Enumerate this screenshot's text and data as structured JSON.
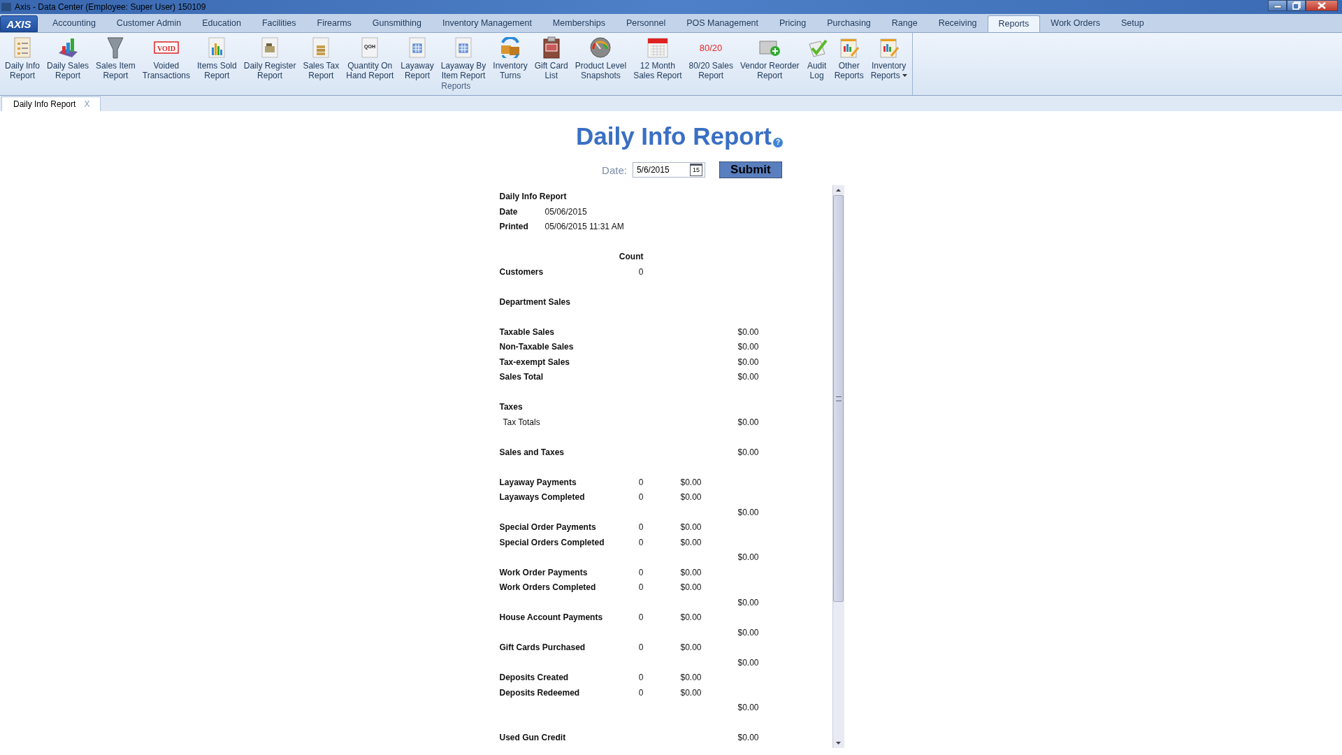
{
  "window": {
    "title": "Axis - Data Center  (Employee: Super User) 150109",
    "logo": "AXIS"
  },
  "menu_tabs": [
    {
      "label": "Accounting",
      "selected": false
    },
    {
      "label": "Customer Admin",
      "selected": false
    },
    {
      "label": "Education",
      "selected": false
    },
    {
      "label": "Facilities",
      "selected": false
    },
    {
      "label": "Firearms",
      "selected": false
    },
    {
      "label": "Gunsmithing",
      "selected": false
    },
    {
      "label": "Inventory Management",
      "selected": false
    },
    {
      "label": "Memberships",
      "selected": false
    },
    {
      "label": "Personnel",
      "selected": false
    },
    {
      "label": "POS Management",
      "selected": false
    },
    {
      "label": "Pricing",
      "selected": false
    },
    {
      "label": "Purchasing",
      "selected": false
    },
    {
      "label": "Range",
      "selected": false
    },
    {
      "label": "Receiving",
      "selected": false
    },
    {
      "label": "Reports",
      "selected": true
    },
    {
      "label": "Work Orders",
      "selected": false
    },
    {
      "label": "Setup",
      "selected": false
    }
  ],
  "ribbon": {
    "group_label": "Reports",
    "buttons": [
      {
        "kind": "doc",
        "label": [
          "Daily Info",
          "Report"
        ]
      },
      {
        "kind": "chart",
        "label": [
          "Daily Sales",
          "Report"
        ]
      },
      {
        "kind": "funnel",
        "label": [
          "Sales Item",
          "Report"
        ]
      },
      {
        "kind": "stamp",
        "icon_text": "VOID",
        "label": [
          "Voided",
          "Transactions"
        ]
      },
      {
        "kind": "bars",
        "label": [
          "Items Sold",
          "Report"
        ]
      },
      {
        "kind": "register",
        "label": [
          "Daily Register",
          "Report"
        ]
      },
      {
        "kind": "coins",
        "label": [
          "Sales Tax",
          "Report"
        ]
      },
      {
        "kind": "textdoc",
        "icon_text": "QOH",
        "label": [
          "Quantity On",
          "Hand Report"
        ]
      },
      {
        "kind": "layaway",
        "label": [
          "Layaway",
          "Report"
        ]
      },
      {
        "kind": "layaway",
        "label": [
          "Layaway By",
          "Item Report"
        ]
      },
      {
        "kind": "turns",
        "label": [
          "Inventory",
          "Turns"
        ]
      },
      {
        "kind": "clipboard",
        "label": [
          "Gift Card",
          "List"
        ]
      },
      {
        "kind": "gauge",
        "label": [
          "Product Level",
          "Snapshots"
        ]
      },
      {
        "kind": "calendar",
        "label": [
          "12 Month",
          "Sales Report"
        ]
      },
      {
        "kind": "ratio",
        "icon_text": "80/20",
        "label": [
          "80/20 Sales",
          "Report"
        ]
      },
      {
        "kind": "po",
        "label": [
          "Vendor Reorder",
          "Report"
        ]
      },
      {
        "kind": "check",
        "label": [
          "Audit",
          "Log"
        ]
      },
      {
        "kind": "report",
        "label": [
          "Other",
          "Reports"
        ]
      },
      {
        "kind": "report",
        "label": [
          "Inventory",
          "Reports"
        ],
        "dropdown": true
      }
    ]
  },
  "doc_tabs": [
    {
      "label": "Daily Info Report",
      "close": "X",
      "selected": true
    }
  ],
  "page": {
    "title": "Daily Info Report",
    "help": "?",
    "date_label": "Date:",
    "date_value": "5/6/2015",
    "calendar_day": "15",
    "submit": "Submit"
  },
  "report": {
    "rows": [
      {
        "kind": "heading",
        "label": "Daily Info Report"
      },
      {
        "kind": "meta",
        "label": "Date",
        "value": "05/06/2015"
      },
      {
        "kind": "meta",
        "label": "Printed",
        "value": "05/06/2015 11:31 AM"
      },
      {
        "kind": "gap"
      },
      {
        "kind": "colhead",
        "count": "Count"
      },
      {
        "kind": "line",
        "label": "Customers",
        "count": "0"
      },
      {
        "kind": "gap"
      },
      {
        "kind": "line",
        "label": "Department Sales"
      },
      {
        "kind": "gap"
      },
      {
        "kind": "line",
        "label": "Taxable Sales",
        "total": "$0.00"
      },
      {
        "kind": "line",
        "label": "Non-Taxable Sales",
        "total": "$0.00"
      },
      {
        "kind": "line",
        "label": "Tax-exempt Sales",
        "total": "$0.00"
      },
      {
        "kind": "line",
        "label": "Sales Total",
        "total": "$0.00"
      },
      {
        "kind": "gap"
      },
      {
        "kind": "line",
        "label": "Taxes"
      },
      {
        "kind": "sub",
        "label": "Tax Totals",
        "total": "$0.00"
      },
      {
        "kind": "gap"
      },
      {
        "kind": "line",
        "label": "Sales and Taxes",
        "total": "$0.00"
      },
      {
        "kind": "gap"
      },
      {
        "kind": "line",
        "label": "Layaway Payments",
        "count": "0",
        "amount": "$0.00"
      },
      {
        "kind": "line",
        "label": "Layaways Completed",
        "count": "0",
        "amount": "$0.00"
      },
      {
        "kind": "line",
        "total": "$0.00"
      },
      {
        "kind": "line",
        "label": "Special Order Payments",
        "count": "0",
        "amount": "$0.00"
      },
      {
        "kind": "line",
        "label": "Special Orders Completed",
        "count": "0",
        "amount": "$0.00"
      },
      {
        "kind": "line",
        "total": "$0.00"
      },
      {
        "kind": "line",
        "label": "Work Order Payments",
        "count": "0",
        "amount": "$0.00"
      },
      {
        "kind": "line",
        "label": "Work Orders Completed",
        "count": "0",
        "amount": "$0.00"
      },
      {
        "kind": "line",
        "total": "$0.00"
      },
      {
        "kind": "line",
        "label": "House Account Payments",
        "count": "0",
        "amount": "$0.00"
      },
      {
        "kind": "line",
        "total": "$0.00"
      },
      {
        "kind": "line",
        "label": "Gift Cards Purchased",
        "count": "0",
        "amount": "$0.00"
      },
      {
        "kind": "line",
        "total": "$0.00"
      },
      {
        "kind": "line",
        "label": "Deposits Created",
        "count": "0",
        "amount": "$0.00"
      },
      {
        "kind": "line",
        "label": "Deposits Redeemed",
        "count": "0",
        "amount": "$0.00"
      },
      {
        "kind": "line",
        "total": "$0.00"
      },
      {
        "kind": "gap"
      },
      {
        "kind": "line",
        "label": "Used Gun Credit",
        "total": "$0.00"
      }
    ]
  }
}
